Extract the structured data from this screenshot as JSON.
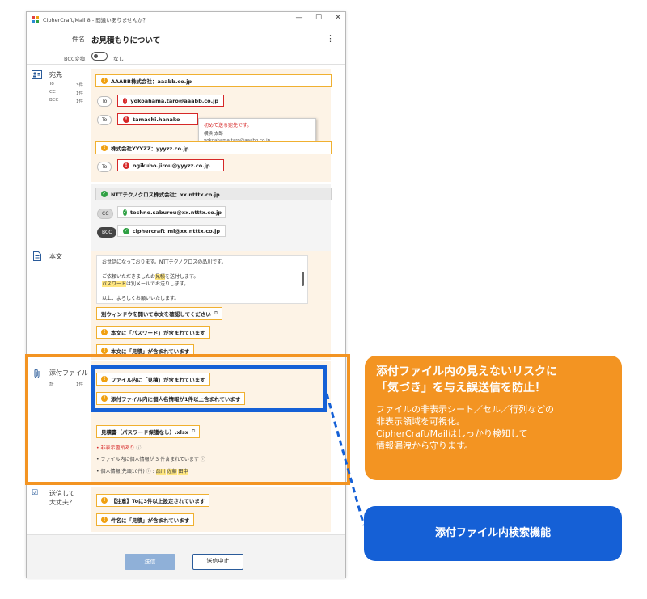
{
  "window": {
    "title": "CipherCraft/Mail 8 - 間違いありませんか？",
    "controls": {
      "minimize": "—",
      "maximize": "☐",
      "close": "✕"
    }
  },
  "header": {
    "subject_label": "件名",
    "subject_value": "お見積もりについて",
    "menu_icon": "⋮",
    "bcc_label": "BCC変換",
    "bcc_value": "なし"
  },
  "recipients": {
    "title": "宛先",
    "counts": [
      {
        "label": "To",
        "value": "3件"
      },
      {
        "label": "CC",
        "value": "1件"
      },
      {
        "label": "BCC",
        "value": "1件"
      }
    ],
    "group1": {
      "domain": "AAABB株式会社：aaabb.co.jp",
      "rows": [
        {
          "kind": "To",
          "address": "yokoahama.taro@aaabb.co.jp"
        },
        {
          "kind": "To",
          "address": "tamachi.hanako"
        }
      ],
      "tooltip": {
        "warning": "初めて送る宛先です。",
        "name": "横浜 太郎",
        "email": "yokoahama.taro@aaabb.co.jp"
      }
    },
    "group2": {
      "domain": "株式会社YYYZZ：yyyzz.co.jp",
      "rows": [
        {
          "kind": "To",
          "address": "ogikubo.jirou@yyyzz.co.jp"
        }
      ]
    },
    "group3": {
      "domain": "NTTテクノクロス株式会社：xx.ntttx.co.jp",
      "rows": [
        {
          "kind": "CC",
          "address": "techno.saburou@xx.ntttx.co.jp"
        },
        {
          "kind": "BCC",
          "address": "ciphercraft_ml@xx.ntttx.co.jp"
        }
      ]
    }
  },
  "body": {
    "title": "本文",
    "line1": "お世話になっております。NTTテクノクロスの品川です。",
    "line2_pre": "ご依頼いただきましたお",
    "line2_hl": "見積",
    "line2_post": "を送付します。",
    "line3_hl": "パスワード",
    "line3_post": "は別メールでお送りします。",
    "line4": "以上、よろしくお願いいたします。",
    "open_window": "別ウィンドウを開いて本文を確認してください",
    "warn1": "本文に「パスワード」が含まれています",
    "warn2": "本文に「見積」が含まれています"
  },
  "attachments": {
    "title": "添付ファイル",
    "count_label": "計",
    "count_value": "1件",
    "warn1": "ファイル内に「見積」が含まれています",
    "warn2": "添付ファイル内に個人名情報が1件以上含まれています",
    "file_name": "見積書（パスワード保護なし）.xlsx",
    "detail1": "非表示箇所あり",
    "detail2": "ファイル内に個人情報が 3 件含まれています",
    "detail3": "個人情報(先頭10件)",
    "names": [
      "品川",
      "佐藤",
      "田中"
    ]
  },
  "checks": {
    "title1": "送信して",
    "title2": "大丈夫？",
    "warn1": "【注意】Toに3件以上設定されています",
    "warn2": "件名に「見積」が含まれています"
  },
  "footer": {
    "send": "送信",
    "cancel": "送信中止"
  },
  "callouts": {
    "orange_h1": "添付ファイル内の見えないリスクに",
    "orange_h2": "「気づき」を与え誤送信を防止！",
    "orange_p1": "ファイルの非表示シート／セル／行列などの",
    "orange_p2": "非表示領域を可視化。",
    "orange_p3": "CipherCraft/Mailはしっかり検知して",
    "orange_p4": "情報漏洩から守ります。",
    "blue": "添付ファイル内検索機能"
  },
  "colors": {
    "orange": "#f39422",
    "blue": "#1560d6",
    "warning": "#f0a010",
    "error": "#d62828",
    "ok": "#2ea043",
    "panel": "#fdf3e6"
  }
}
